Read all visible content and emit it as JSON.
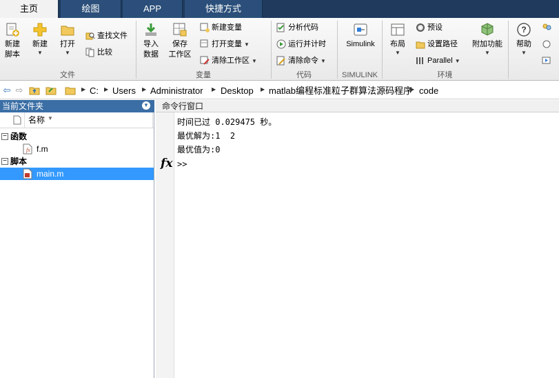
{
  "tabs": [
    {
      "label": "主页",
      "active": true
    },
    {
      "label": "绘图",
      "active": false
    },
    {
      "label": "APP",
      "active": false
    },
    {
      "label": "快捷方式",
      "active": false
    }
  ],
  "ribbon": {
    "file": {
      "group_label": "文件",
      "new_script_line1": "新建",
      "new_script_line2": "脚本",
      "new": "新建",
      "open": "打开",
      "find_files": "查找文件",
      "compare": "比较"
    },
    "variable": {
      "group_label": "变量",
      "import_line1": "导入",
      "import_line2": "数据",
      "save_line1": "保存",
      "save_line2": "工作区",
      "new_variable": "新建变量",
      "open_variable": "打开变量",
      "clear_workspace": "清除工作区"
    },
    "code": {
      "group_label": "代码",
      "analyze": "分析代码",
      "run_time": "运行并计时",
      "clear_commands": "清除命令"
    },
    "simulink": {
      "group_label": "SIMULINK",
      "label": "Simulink"
    },
    "environment": {
      "group_label": "环境",
      "layout": "布局",
      "preferences": "预设",
      "set_path": "设置路径",
      "parallel": "Parallel",
      "addons": "附加功能"
    },
    "resources": {
      "help": "帮助"
    }
  },
  "address": {
    "crumbs": [
      "C:",
      "Users",
      "Administrator",
      "Desktop",
      "matlab编程标准粒子群算法源码程序",
      "code"
    ]
  },
  "current_folder": {
    "title": "当前文件夹",
    "column_name": "名称",
    "sections": [
      {
        "label": "函数",
        "files": [
          "f.m"
        ]
      },
      {
        "label": "脚本",
        "files": [
          "main.m"
        ]
      }
    ]
  },
  "command_window": {
    "title": "命令行窗口",
    "lines": [
      "时间已过 0.029475 秒。",
      "最优解为:1  2",
      "最优值为:0"
    ],
    "prompt": ">>"
  },
  "colors": {
    "tab_bar": "#1f3a5c",
    "panel_title": "#3a6ea5",
    "selection": "#3399ff"
  }
}
